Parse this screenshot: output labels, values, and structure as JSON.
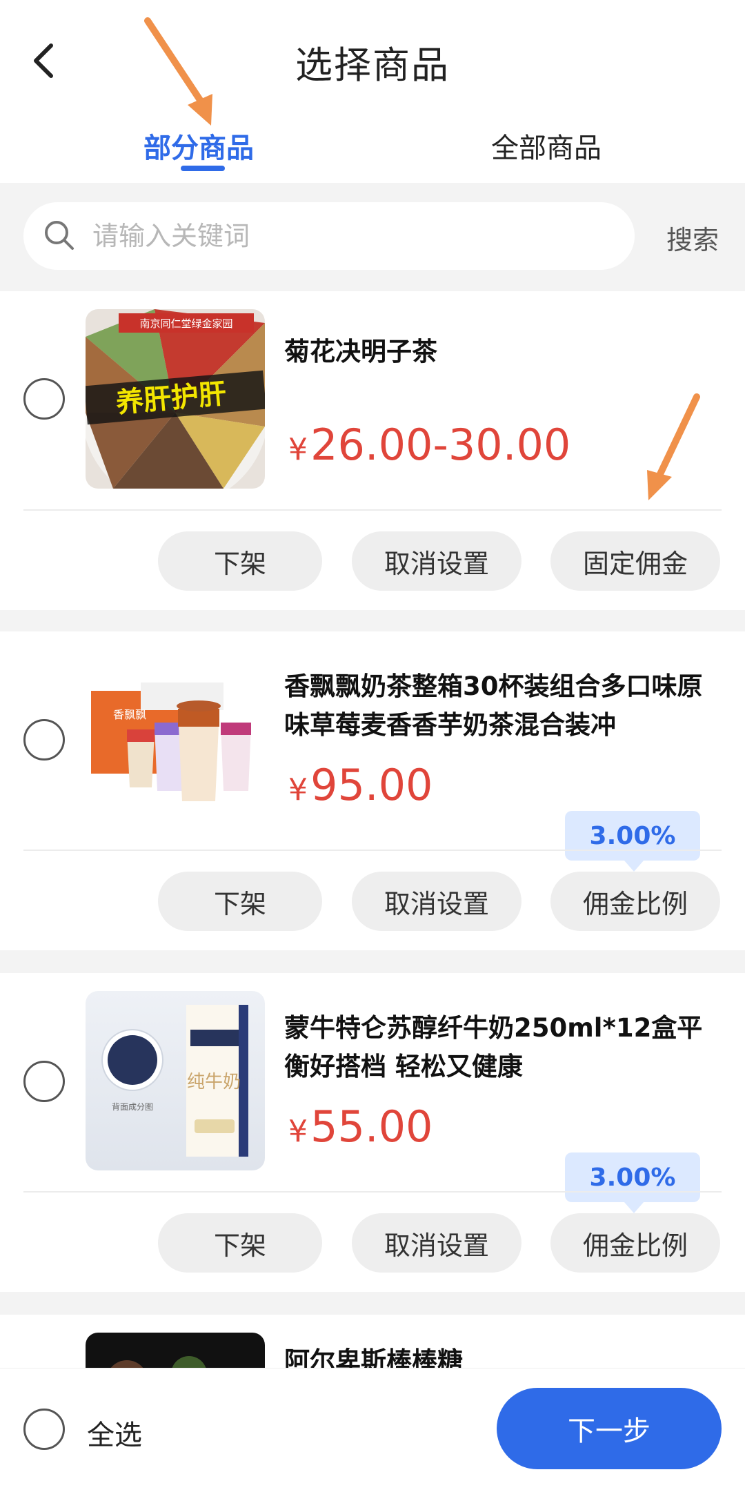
{
  "header": {
    "title": "选择商品",
    "tabs": [
      {
        "label": "部分商品",
        "active": true
      },
      {
        "label": "全部商品",
        "active": false
      }
    ]
  },
  "search": {
    "placeholder": "请输入关键词",
    "value": "",
    "button_label": "搜索"
  },
  "products": [
    {
      "name": "菊花决明子茶",
      "price": "26.00-30.00",
      "thumb_text": {
        "top": "南京同仁堂绿金家园",
        "banner": "养肝护肝"
      },
      "actions": {
        "off": "下架",
        "cancel": "取消设置",
        "commission": "固定佣金"
      }
    },
    {
      "name": "香飘飘奶茶整箱30杯装组合多口味原味草莓麦香香芋奶茶混合装冲",
      "price": "95.00",
      "commission_rate": "3.00%",
      "thumb_text": {
        "brand": "香飘飘"
      },
      "actions": {
        "off": "下架",
        "cancel": "取消设置",
        "commission": "佣金比例"
      }
    },
    {
      "name": "蒙牛特仑苏醇纤牛奶250ml*12盒平衡好搭档 轻松又健康",
      "price": "55.00",
      "commission_rate": "3.00%",
      "thumb_text": {
        "pack": "纯牛奶",
        "label": "背面成分图"
      },
      "actions": {
        "off": "下架",
        "cancel": "取消设置",
        "commission": "佣金比例"
      }
    },
    {
      "name": "阿尔卑斯棒棒糖"
    }
  ],
  "currency_symbol": "¥",
  "footer": {
    "select_all_label": "全选",
    "next_label": "下一步"
  },
  "colors": {
    "accent": "#2f6be8",
    "price": "#e0453a",
    "annotation_arrow": "#f0914a"
  }
}
